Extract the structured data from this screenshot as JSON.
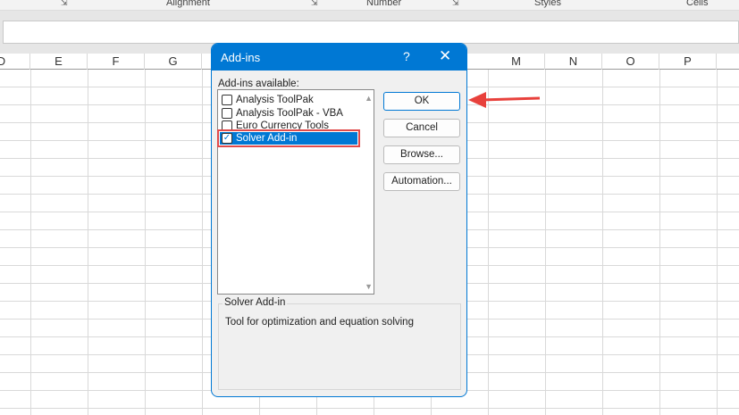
{
  "ribbon": {
    "groups": [
      "Alignment",
      "Number",
      "Styles",
      "Cells"
    ]
  },
  "columns": {
    "D": "D",
    "E": "E",
    "F": "F",
    "G": "G",
    "M": "M",
    "N": "N",
    "O": "O",
    "P": "P"
  },
  "dialog": {
    "title": "Add-ins",
    "help": "?",
    "close": "✕",
    "list_label": "Add-ins available:",
    "items": [
      {
        "label": "Analysis ToolPak",
        "checked": false
      },
      {
        "label": "Analysis ToolPak - VBA",
        "checked": false
      },
      {
        "label": "Euro Currency Tools",
        "checked": false
      },
      {
        "label": "Solver Add-in",
        "checked": true
      }
    ],
    "buttons": {
      "ok": "OK",
      "cancel": "Cancel",
      "browse": "Browse...",
      "automation": "Automation..."
    },
    "group_title": "Solver Add-in",
    "description": "Tool for optimization and equation solving"
  },
  "annotation_color": "#e8413c"
}
